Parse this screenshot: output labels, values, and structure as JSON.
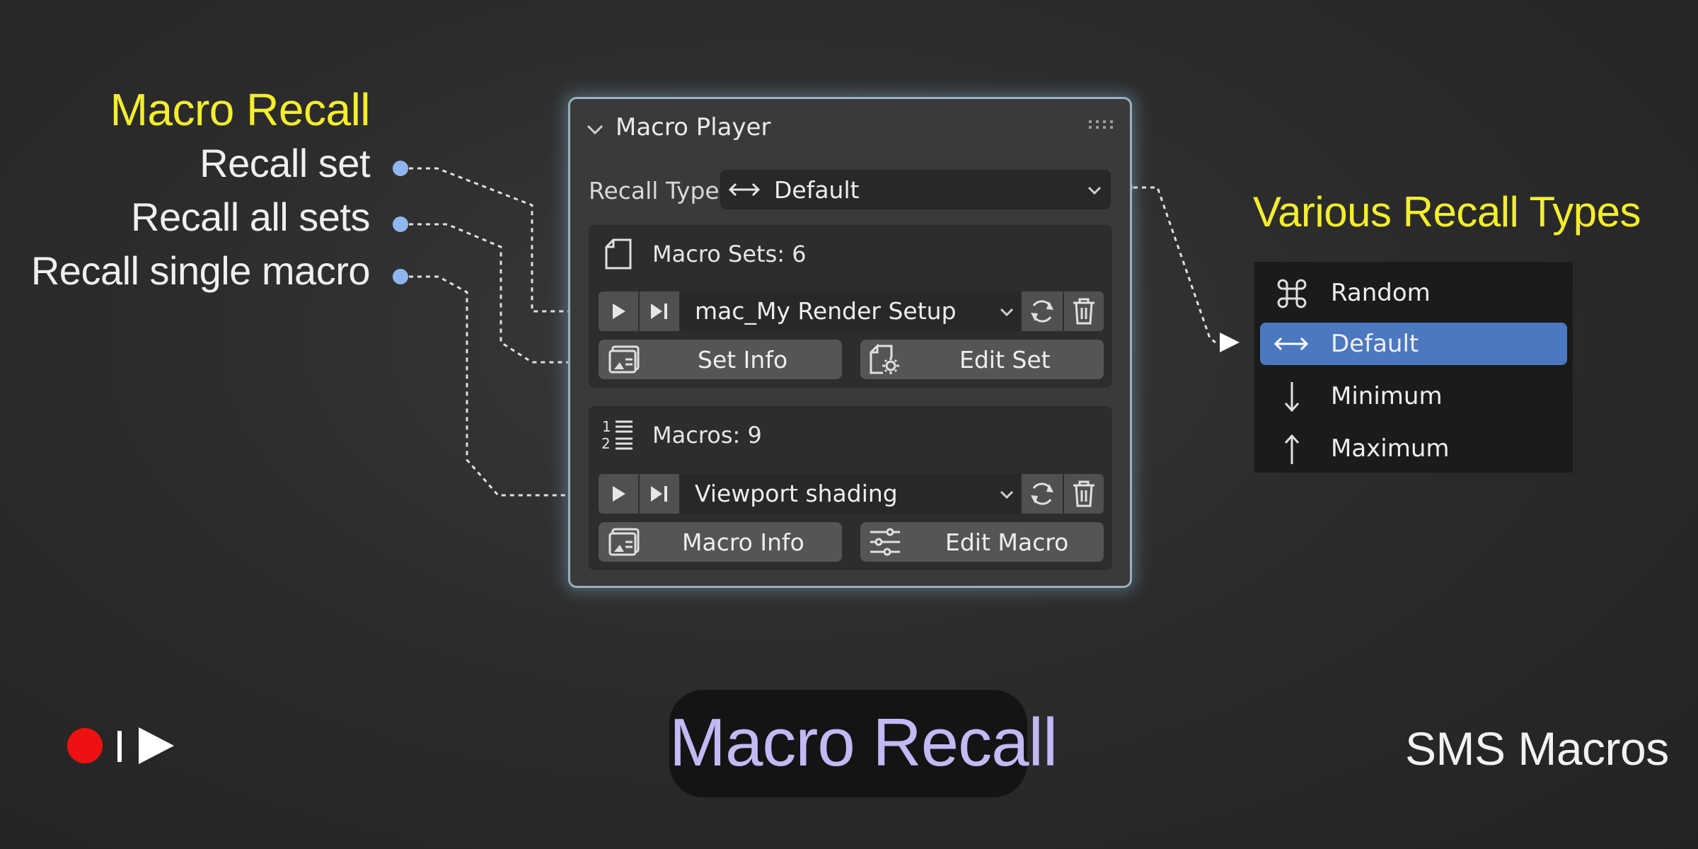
{
  "annotations": {
    "left_title": "Macro Recall",
    "items": [
      "Recall set",
      "Recall all sets",
      "Recall single macro"
    ],
    "right_title": "Various Recall Types"
  },
  "panel": {
    "title": "Macro Player",
    "recall_type_label": "Recall Type:",
    "recall_type_value": "Default",
    "sets": {
      "label": "Macro Sets: 6",
      "selected": "mac_My Render Setup",
      "info_button": "Set Info",
      "edit_button": "Edit Set"
    },
    "macros": {
      "label": "Macros: 9",
      "selected": "Viewport shading",
      "info_button": "Macro Info",
      "edit_button": "Edit Macro"
    }
  },
  "recall_menu": {
    "items": [
      {
        "label": "Random",
        "icon": "command-icon",
        "selected": false
      },
      {
        "label": "Default",
        "icon": "double-arrow-icon",
        "selected": true
      },
      {
        "label": "Minimum",
        "icon": "arrow-down-icon",
        "selected": false
      },
      {
        "label": "Maximum",
        "icon": "arrow-up-icon",
        "selected": false
      }
    ]
  },
  "footer": {
    "title": "Macro Recall",
    "brand": "SMS Macros"
  },
  "colors": {
    "accent_yellow": "#f4ee2c",
    "connector_blue": "#8fb6ee",
    "selection_blue": "#4c78c0",
    "record_red": "#ee1111",
    "title_lavender": "#c4b8f5"
  }
}
